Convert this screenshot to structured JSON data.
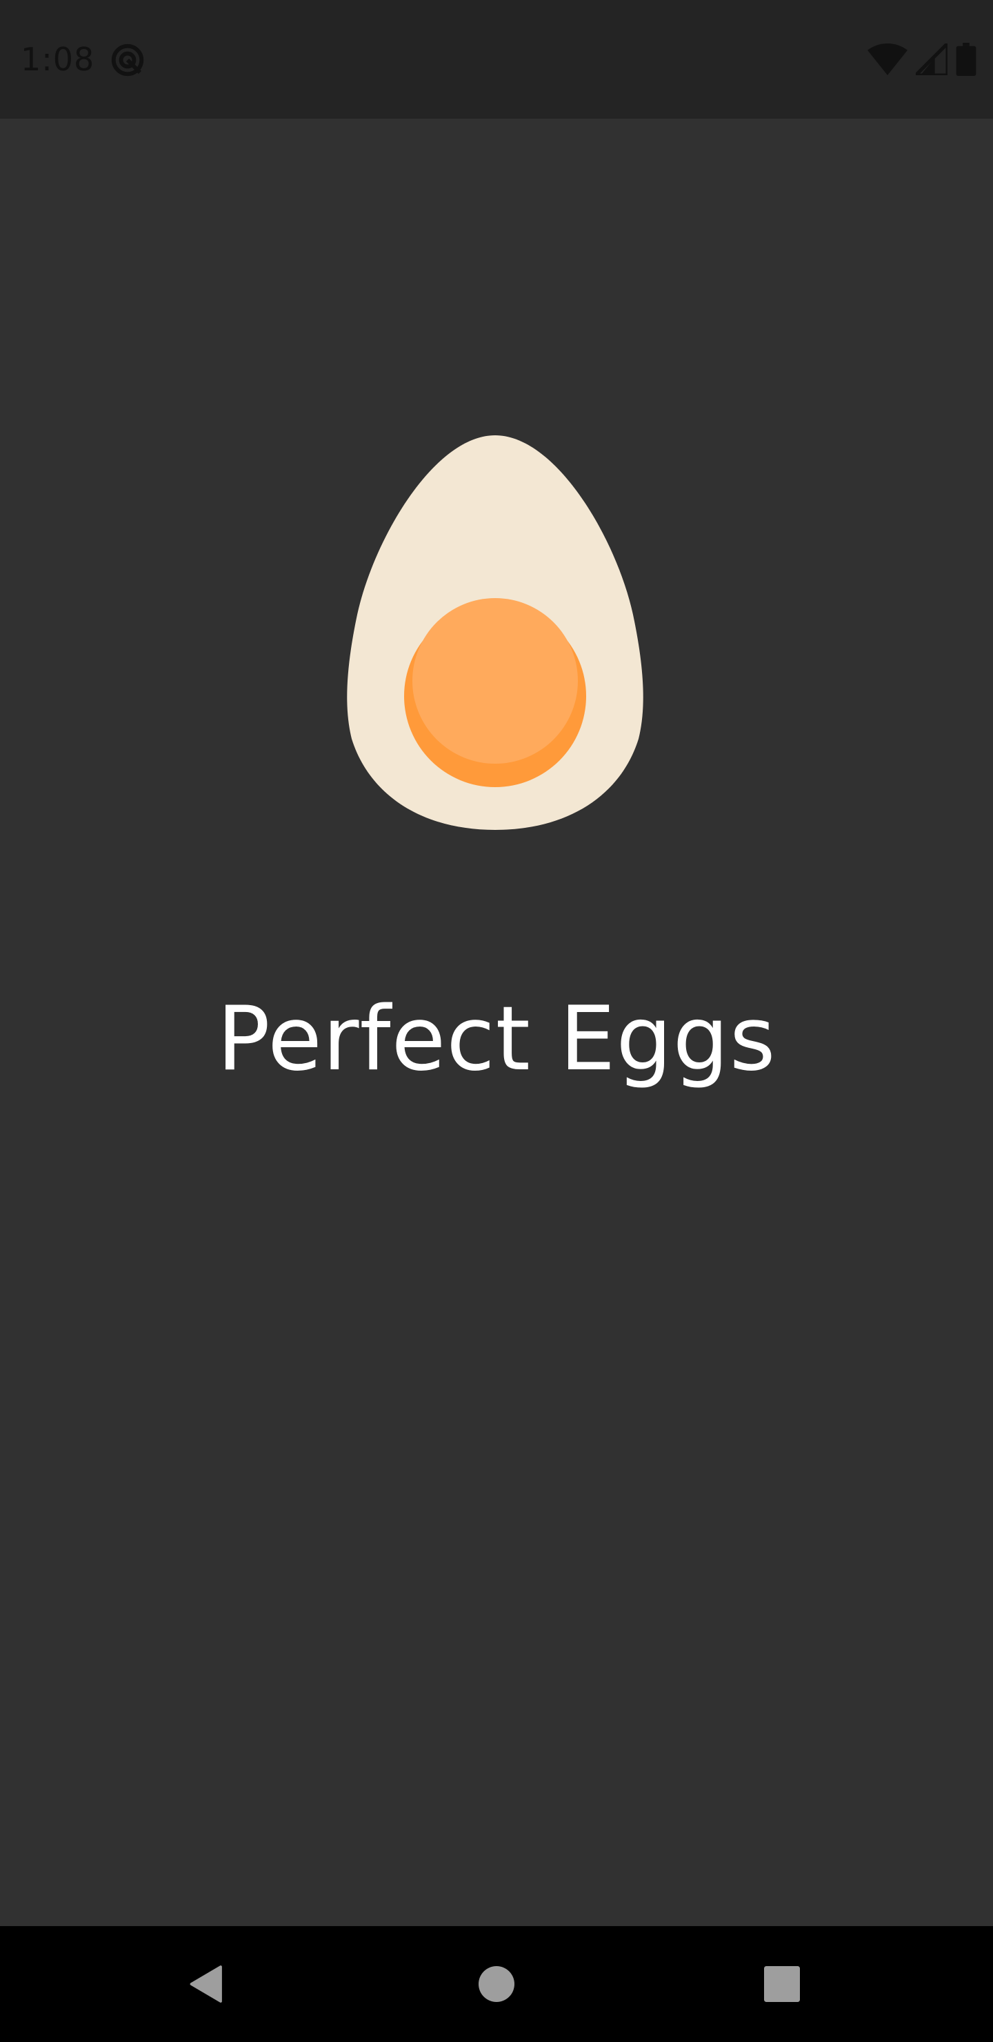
{
  "status_bar": {
    "time": "1:08",
    "icons": [
      "sync-icon",
      "wifi-icon",
      "cell-signal-icon",
      "battery-icon"
    ]
  },
  "app": {
    "title": "Perfect Eggs",
    "logo_icon": "boiled-egg-icon"
  },
  "colors": {
    "background": "#313131",
    "status_bar": "#242424",
    "egg_white": "#F3E7D3",
    "yolk": "#FFAA5C",
    "yolk_shade": "#FF9A3A",
    "title_text": "#FFFFFF",
    "nav_bar": "#000000",
    "nav_icons": "#9E9E9E"
  },
  "nav_bar": {
    "buttons": [
      "back-button",
      "home-button",
      "recents-button"
    ]
  }
}
